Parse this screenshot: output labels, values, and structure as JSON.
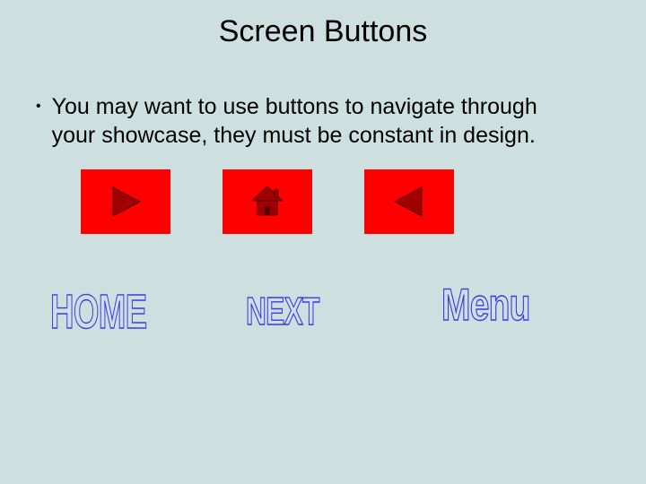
{
  "title": "Screen Buttons",
  "bullet": "You may want to use buttons to navigate through your showcase,  they must be constant in design.",
  "wordart": {
    "home": "HOME",
    "next": "NEXT",
    "menu": "Menu"
  },
  "colors": {
    "background": "#cde0df",
    "button_bg": "#ff0000",
    "icon_fill": "#a00000",
    "wordart_stroke": "#3a3ae6"
  }
}
